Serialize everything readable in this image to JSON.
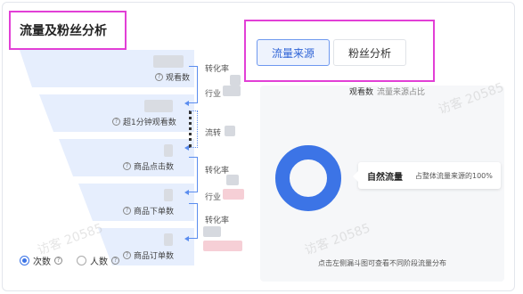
{
  "panel": {
    "title": "流量及粉丝分析"
  },
  "funnel": {
    "stages": [
      {
        "label": "观看数"
      },
      {
        "label": "超1分钟观看数"
      },
      {
        "label": "商品点击数"
      },
      {
        "label": "商品下单数"
      },
      {
        "label": "商品订单数"
      }
    ],
    "rates": [
      {
        "label": "转化率",
        "sub": "行业"
      },
      {
        "label": "流转"
      },
      {
        "label": "转化率",
        "sub": "行业"
      },
      {
        "label": "转化率"
      }
    ],
    "mode_options": [
      {
        "label": "次数",
        "selected": true
      },
      {
        "label": "人数",
        "selected": false
      }
    ]
  },
  "tabs": [
    {
      "label": "流量来源",
      "active": true
    },
    {
      "label": "粉丝分析",
      "active": false
    }
  ],
  "source_chart": {
    "metric": "观看数",
    "caption": "流量来源占比",
    "callout_source": "自然流量",
    "callout_text": "占整体流量来源的100%",
    "hint": "点击左侧漏斗图可查看不同阶段流量分布",
    "slice_percent": 100,
    "color": "#3c74e6"
  },
  "watermark": "访客 20585",
  "colors": {
    "accent": "#3c74e6",
    "highlight_box": "#e23fd6",
    "funnel": "#e6eefd"
  }
}
